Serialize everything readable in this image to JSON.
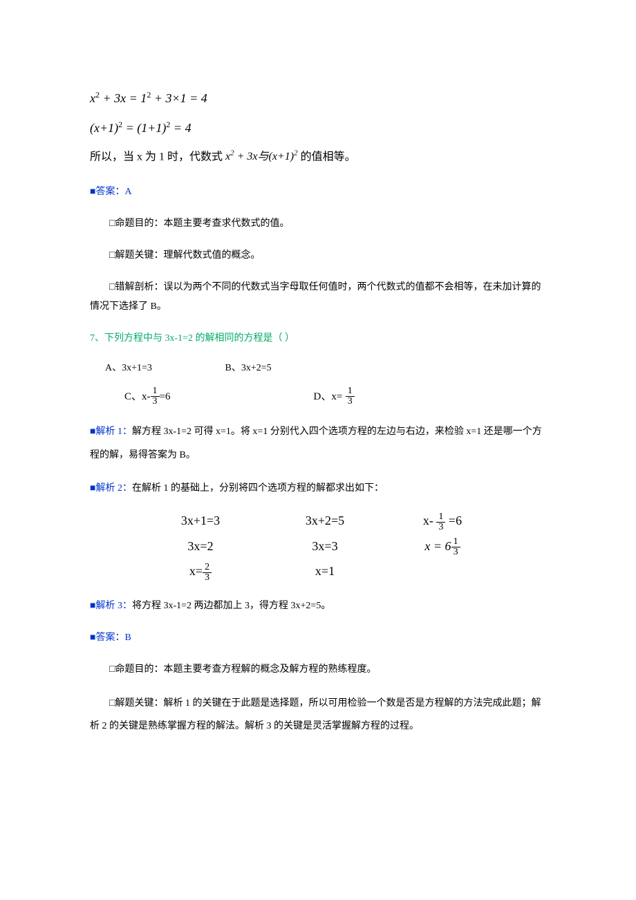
{
  "eq1": "x² + 3x = 1² + 3×1 = 4",
  "eq2": "(x+1)² = (1+1)² = 4",
  "conclusion_prefix": "所以，当 x 为 1 时，代数式 ",
  "conclusion_math": "x² + 3x 与 (x+1)²",
  "conclusion_suffix": " 的值相等。",
  "answer6_label": "■答案：A",
  "purpose6_label": "□命题目的：",
  "purpose6_text": "本题主要考查求代数式的值。",
  "key6_label": "□解题关键：",
  "key6_text": "理解代数式值的概念。",
  "error6_label": "□错解剖析：",
  "error6_text": "误以为两个不同的代数式当字母取任何值时，两个代数式的值都不会相等，在未加计算的情况下选择了 B。",
  "q7_number": "7、",
  "q7_text": "下列方程中与 3x-1=2 的解相同的方程是（  ）",
  "q7_option_a": "A、3x+1=3",
  "q7_option_b": "B、3x+2=5",
  "q7_option_c_prefix": "C、x-",
  "q7_option_c_suffix": "=6",
  "q7_option_d_prefix": "D、x=",
  "analysis1_label": "■解析 1：",
  "analysis1_text": "解方程 3x-1=2 可得 x=1。将 x=1 分别代入四个选项方程的左边与右边，来检验 x=1 还是哪一个方程的解，易得答案为 B。",
  "analysis2_label": "■解析 2：",
  "analysis2_text": "在解析 1 的基础上，分别将四个选项方程的解都求出如下：",
  "eq_table": {
    "r1c1": "3x+1=3",
    "r1c2": "3x+2=5",
    "r1c3_prefix": "x- ",
    "r1c3_suffix": " =6",
    "r2c1": "3x=2",
    "r2c2": "3x=3",
    "r2c3_prefix": "x = 6",
    "r3c1_prefix": "x=",
    "r3c2": "x=1"
  },
  "analysis3_label": "■解析 3：",
  "analysis3_text": "将方程 3x-1=2 两边都加上 3，得方程 3x+2=5。",
  "answer7_label": "■答案：B",
  "purpose7_label": "□命题目的：",
  "purpose7_text": "本题主要考查方程解的概念及解方程的熟练程度。",
  "key7_label": "□解题关键：",
  "key7_text": "解析 1 的关键在于此题是选择题，所以可用检验一个数是否是方程解的方法完成此题；解析 2 的关键是熟练掌握方程的解法。解析 3 的关键是灵活掌握解方程的过程。",
  "frac_1_3_num": "1",
  "frac_1_3_den": "3",
  "frac_2_3_num": "2",
  "frac_2_3_den": "3"
}
